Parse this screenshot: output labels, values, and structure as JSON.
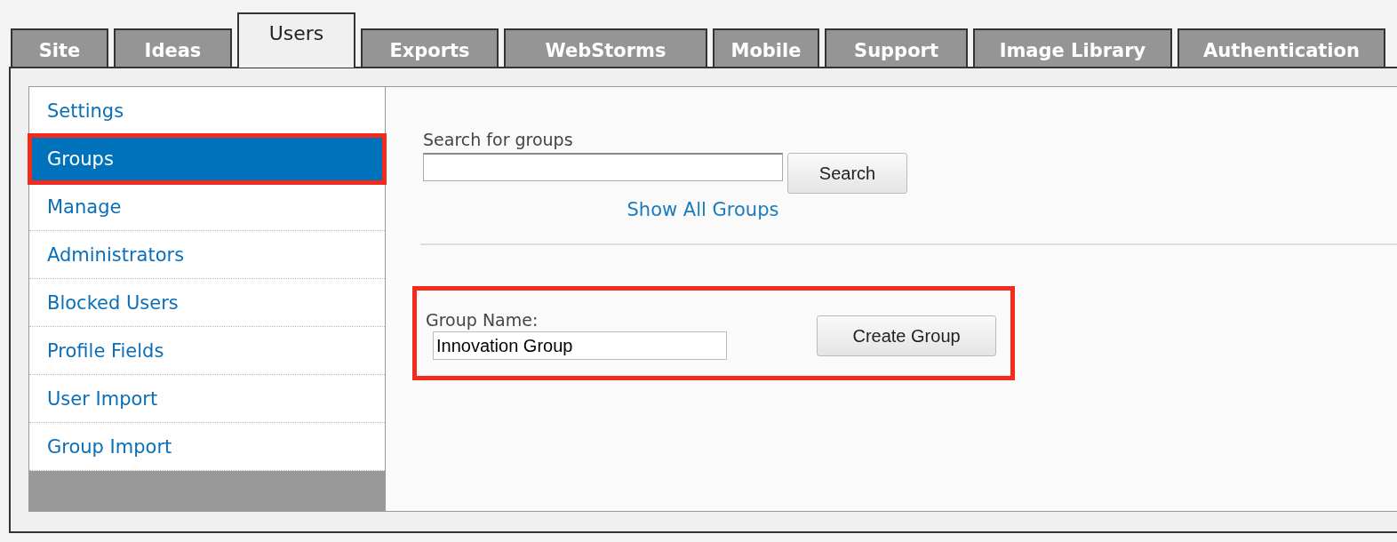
{
  "tabs": [
    {
      "label": "Site",
      "selected": false
    },
    {
      "label": "Ideas",
      "selected": false
    },
    {
      "label": "Users",
      "selected": true
    },
    {
      "label": "Exports",
      "selected": false
    },
    {
      "label": "WebStorms",
      "selected": false
    },
    {
      "label": "Mobile",
      "selected": false
    },
    {
      "label": "Support",
      "selected": false
    },
    {
      "label": "Image Library",
      "selected": false
    },
    {
      "label": "Authentication",
      "selected": false
    }
  ],
  "sidebar": {
    "items": [
      {
        "label": "Settings",
        "selected": false,
        "highlighted": false
      },
      {
        "label": "Groups",
        "selected": true,
        "highlighted": true
      },
      {
        "label": "Manage",
        "selected": false,
        "highlighted": false
      },
      {
        "label": "Administrators",
        "selected": false,
        "highlighted": false
      },
      {
        "label": "Blocked Users",
        "selected": false,
        "highlighted": false
      },
      {
        "label": "Profile Fields",
        "selected": false,
        "highlighted": false
      },
      {
        "label": "User Import",
        "selected": false,
        "highlighted": false
      },
      {
        "label": "Group Import",
        "selected": false,
        "highlighted": false
      }
    ]
  },
  "search": {
    "label": "Search for groups",
    "button": "Search",
    "show_all_link": "Show All Groups"
  },
  "create_group": {
    "highlighted": true,
    "label": "Group Name:",
    "value": "Innovation Group",
    "button": "Create Group"
  }
}
